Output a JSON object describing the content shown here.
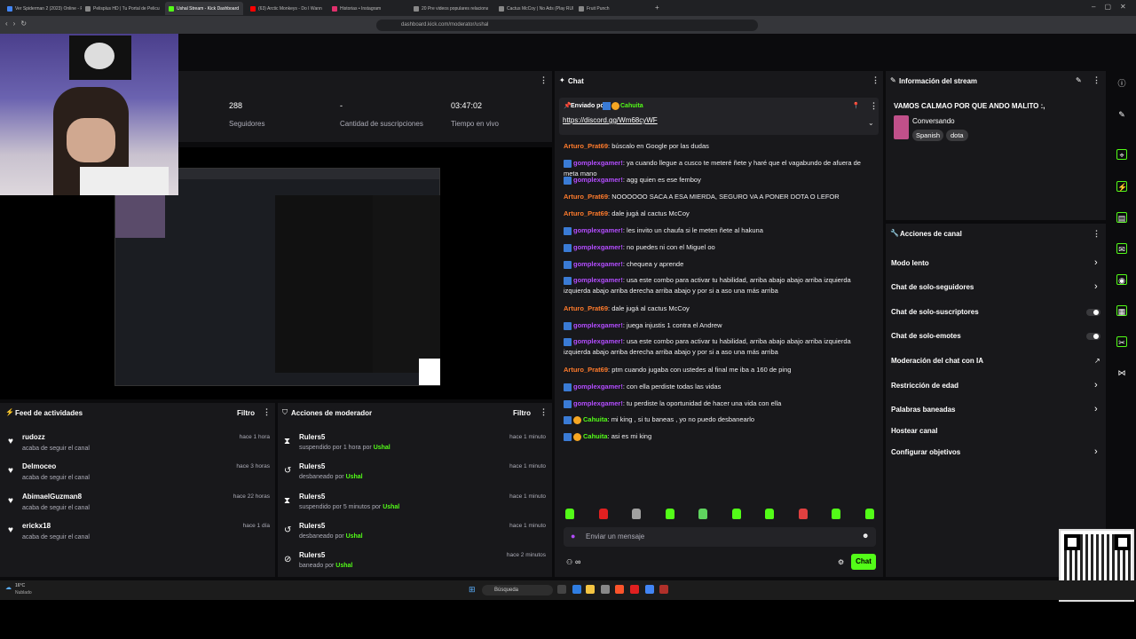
{
  "browser": {
    "tabs": [
      {
        "label": "Ver Spiderman 2 (2023) Online - Pe",
        "color": "#4285f4"
      },
      {
        "label": "Pelisplus HD | Tu Portal de Peliculas",
        "color": "#888"
      },
      {
        "label": "Ushal Stream - Kick Dashboard",
        "color": "#53fc18",
        "active": true
      },
      {
        "label": "(63) Arctic Monkeys - Do I Wann",
        "color": "#ff0000"
      },
      {
        "label": "Historias • Instagram",
        "color": "#e1306c"
      },
      {
        "label": "20 Pre videos populares relacionad",
        "color": "#888"
      },
      {
        "label": "Cactus McCoy | No Ads (Play RUN)",
        "color": "#888"
      },
      {
        "label": "Fruit Punch",
        "color": "#888"
      }
    ],
    "new_tab": "+",
    "url": "dashboard.kick.com/moderator/ushal"
  },
  "stats": [
    {
      "value": "288",
      "label": "Seguidores"
    },
    {
      "value": "-",
      "label": "Cantidad de suscripciones"
    },
    {
      "value": "03:47:02",
      "label": "Tiempo en vivo"
    }
  ],
  "chat": {
    "title": "Chat",
    "pinned": {
      "prefix": "Enviado por",
      "user": "Cahuita",
      "link": "https://discord.gg/Wm68cyWF"
    },
    "messages": [
      {
        "user": "Arturo_Prat69",
        "color": "orange",
        "badge": false,
        "text": "búscalo en Google por las dudas"
      },
      {
        "user": "gomplexgamer!",
        "color": "purple",
        "badge": true,
        "text": "ya cuando llegue a cusco te meteré ñete y haré que el vagabundo de afuera de meta mano"
      },
      {
        "user": "gomplexgamer!",
        "color": "purple",
        "badge": true,
        "text": "agg quien es ese femboy"
      },
      {
        "user": "Arturo_Prat69",
        "color": "orange",
        "badge": false,
        "text": "NOOOOOO SACA A ESA MIERDA, SEGURO VA A PONER DOTA O LEFOR"
      },
      {
        "user": "Arturo_Prat69",
        "color": "orange",
        "badge": false,
        "text": "dale jugá al cactus McCoy"
      },
      {
        "user": "gomplexgamer!",
        "color": "purple",
        "badge": true,
        "text": "les invito un chaufa si le meten ñete al hakuna"
      },
      {
        "user": "gomplexgamer!",
        "color": "purple",
        "badge": true,
        "text": "no puedes ni con el Miguel oo"
      },
      {
        "user": "gomplexgamer!",
        "color": "purple",
        "badge": true,
        "text": "chequea y aprende"
      },
      {
        "user": "gomplexgamer!",
        "color": "purple",
        "badge": true,
        "text": "usa este combo para activar tu habilidad, arriba abajo abajo arriba izquierda izquierda abajo arriba derecha arriba abajo y por si a aso una más arriba"
      },
      {
        "user": "Arturo_Prat69",
        "color": "orange",
        "badge": false,
        "text": "dale jugá al cactus McCoy"
      },
      {
        "user": "gomplexgamer!",
        "color": "purple",
        "badge": true,
        "text": "juega injustis 1 contra el Andrew"
      },
      {
        "user": "gomplexgamer!",
        "color": "purple",
        "badge": true,
        "text": "usa este combo para activar tu habilidad, arriba abajo abajo arriba izquierda izquierda abajo arriba derecha arriba abajo y por si a aso una más arriba"
      },
      {
        "user": "Arturo_Prat69",
        "color": "orange",
        "badge": false,
        "text": "ptm cuando jugaba con ustedes al final me iba a 160 de ping"
      },
      {
        "user": "gomplexgamer!",
        "color": "purple",
        "badge": true,
        "text": "con ella perdiste todas las vidas"
      },
      {
        "user": "gomplexgamer!",
        "color": "purple",
        "badge": true,
        "text": "tu perdiste la oportunidad de hacer una vida con ella"
      },
      {
        "user": "Cahuita",
        "color": "green",
        "badge": true,
        "text": "mi king , si tu baneas , yo no puedo desbanearlo"
      },
      {
        "user": "Cahuita",
        "color": "green",
        "badge": true,
        "text": "asi es mi king"
      }
    ],
    "input_placeholder": "Enviar un mensaje",
    "send_label": "Chat",
    "infinity": "∞"
  },
  "stream_info": {
    "title": "Información del stream",
    "stream_title": "VAMOS CALMAO POR QUE ANDO MALITO :,",
    "category": "Conversando",
    "tags": [
      "Spanish",
      "dota"
    ]
  },
  "channel_actions": {
    "title": "Acciones de canal",
    "items": [
      {
        "label": "Modo lento",
        "kind": "chevron"
      },
      {
        "label": "Chat de solo-seguidores",
        "kind": "chevron"
      },
      {
        "label": "Chat de solo-suscriptores",
        "kind": "toggle"
      },
      {
        "label": "Chat de solo-emotes",
        "kind": "toggle"
      },
      {
        "label": "Moderación del chat con IA",
        "kind": "external"
      },
      {
        "label": "Restricción de edad",
        "kind": "chevron"
      },
      {
        "label": "Palabras baneadas",
        "kind": "chevron"
      },
      {
        "label": "Hostear canal",
        "kind": "none"
      },
      {
        "label": "Configurar objetivos",
        "kind": "chevron"
      }
    ]
  },
  "activity_feed": {
    "title": "Feed de actividades",
    "filter": "Filtro",
    "items": [
      {
        "name": "rudozz",
        "sub": "acaba de seguir el canal",
        "time": "hace 1 hora"
      },
      {
        "name": "Delmoceo",
        "sub": "acaba de seguir el canal",
        "time": "hace 3 horas"
      },
      {
        "name": "AbimaelGuzman8",
        "sub": "acaba de seguir el canal",
        "time": "hace 22 horas"
      },
      {
        "name": "erickx18",
        "sub": "acaba de seguir el canal",
        "time": "hace 1 día"
      }
    ]
  },
  "mod_actions": {
    "title": "Acciones de moderador",
    "filter": "Filtro",
    "items": [
      {
        "name": "Rulers5",
        "action": "suspendido por 1 hora por",
        "by": "Ushal",
        "time": "hace 1 minuto",
        "icon": "hourglass"
      },
      {
        "name": "Rulers5",
        "action": "desbaneado por",
        "by": "Ushal",
        "time": "hace 1 minuto",
        "icon": "undo"
      },
      {
        "name": "Rulers5",
        "action": "suspendido por 5 minutos por",
        "by": "Ushal",
        "time": "hace 1 minuto",
        "icon": "hourglass"
      },
      {
        "name": "Rulers5",
        "action": "desbaneado por",
        "by": "Ushal",
        "time": "hace 1 minuto",
        "icon": "undo"
      },
      {
        "name": "Rulers5",
        "action": "baneado por",
        "by": "Ushal",
        "time": "hace 2 minutos",
        "icon": "ban"
      }
    ]
  },
  "taskbar": {
    "search_label": "Búsqueda",
    "weather_temp": "16°C",
    "weather_desc": "Nublado"
  },
  "colors": {
    "accent": "#53fc18",
    "panel": "#18181b",
    "background": "#0b0b0d"
  }
}
